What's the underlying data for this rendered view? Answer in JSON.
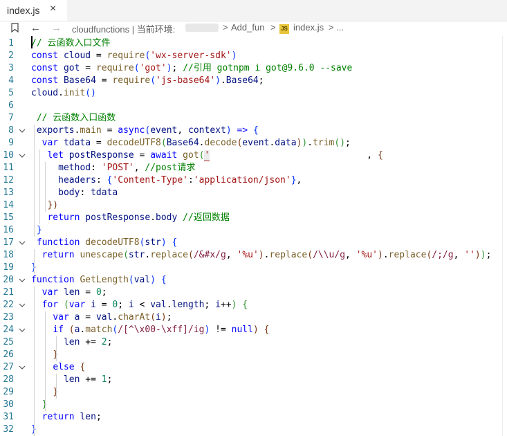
{
  "tab": {
    "filename": "index.js",
    "close_glyph": "×"
  },
  "breadcrumb": {
    "back_glyph": "←",
    "forward_glyph": "→",
    "path_part1": "cloudfunctions | 当前环境:",
    "sep1": ">",
    "path_folder": "Add_fun",
    "sep2": ">",
    "file_badge": "JS",
    "file": "index.js",
    "tail": "> ..."
  },
  "editor": {
    "lines": [
      {
        "n": "1",
        "fold": false,
        "tokens": [
          {
            "t": "// 云函数入口文件",
            "c": "com"
          }
        ]
      },
      {
        "n": "2",
        "fold": false,
        "tokens": [
          {
            "t": "const ",
            "c": "kw"
          },
          {
            "t": "cloud",
            "c": "var"
          },
          {
            "t": " = ",
            "c": ""
          },
          {
            "t": "require",
            "c": "fn"
          },
          {
            "t": "(",
            "c": "b1"
          },
          {
            "t": "'wx-server-sdk'",
            "c": "str"
          },
          {
            "t": ")",
            "c": "b1"
          }
        ]
      },
      {
        "n": "3",
        "fold": false,
        "tokens": [
          {
            "t": "const ",
            "c": "kw"
          },
          {
            "t": "got",
            "c": "var"
          },
          {
            "t": " = ",
            "c": ""
          },
          {
            "t": "require",
            "c": "fn"
          },
          {
            "t": "(",
            "c": "b1"
          },
          {
            "t": "'got'",
            "c": "str"
          },
          {
            "t": ")",
            "c": "b1"
          },
          {
            "t": "; ",
            "c": ""
          },
          {
            "t": "//引用 gotnpm i got@9.6.0 --save",
            "c": "com"
          }
        ]
      },
      {
        "n": "4",
        "fold": false,
        "tokens": [
          {
            "t": "const ",
            "c": "kw"
          },
          {
            "t": "Base64",
            "c": "var"
          },
          {
            "t": " = ",
            "c": ""
          },
          {
            "t": "require",
            "c": "fn"
          },
          {
            "t": "(",
            "c": "b1"
          },
          {
            "t": "'js-base64'",
            "c": "str"
          },
          {
            "t": ")",
            "c": "b1"
          },
          {
            "t": ".",
            "c": ""
          },
          {
            "t": "Base64",
            "c": "var"
          },
          {
            "t": ";",
            "c": ""
          }
        ]
      },
      {
        "n": "5",
        "fold": false,
        "tokens": [
          {
            "t": "cloud",
            "c": "var"
          },
          {
            "t": ".",
            "c": ""
          },
          {
            "t": "init",
            "c": "fn"
          },
          {
            "t": "()",
            "c": "b1"
          }
        ]
      },
      {
        "n": "6",
        "fold": false,
        "tokens": []
      },
      {
        "n": "7",
        "fold": false,
        "tokens": [
          {
            "t": " // 云函数入口函数",
            "c": "com"
          }
        ]
      },
      {
        "n": "8",
        "fold": true,
        "tokens": [
          {
            "t": " ",
            "c": ""
          },
          {
            "t": "exports",
            "c": "var"
          },
          {
            "t": ".",
            "c": ""
          },
          {
            "t": "main",
            "c": "fn"
          },
          {
            "t": " = ",
            "c": ""
          },
          {
            "t": "async",
            "c": "kw"
          },
          {
            "t": "(",
            "c": "b1"
          },
          {
            "t": "event",
            "c": "var"
          },
          {
            "t": ", ",
            "c": ""
          },
          {
            "t": "context",
            "c": "var"
          },
          {
            "t": ")",
            "c": "b1"
          },
          {
            "t": " => ",
            "c": "kw"
          },
          {
            "t": "{",
            "c": "b1"
          }
        ]
      },
      {
        "n": "9",
        "fold": false,
        "tokens": [
          {
            "t": "  ",
            "c": ""
          },
          {
            "t": "var ",
            "c": "kw"
          },
          {
            "t": "tdata",
            "c": "var"
          },
          {
            "t": " = ",
            "c": ""
          },
          {
            "t": "decodeUTF8",
            "c": "fn"
          },
          {
            "t": "(",
            "c": "b2"
          },
          {
            "t": "Base64",
            "c": "var"
          },
          {
            "t": ".",
            "c": ""
          },
          {
            "t": "decode",
            "c": "fn"
          },
          {
            "t": "(",
            "c": "b3"
          },
          {
            "t": "event",
            "c": "var"
          },
          {
            "t": ".",
            "c": ""
          },
          {
            "t": "data",
            "c": "var"
          },
          {
            "t": ")",
            "c": "b3"
          },
          {
            "t": ")",
            "c": "b2"
          },
          {
            "t": ".",
            "c": ""
          },
          {
            "t": "trim",
            "c": "fn"
          },
          {
            "t": "()",
            "c": "b2"
          },
          {
            "t": ";",
            "c": ""
          }
        ]
      },
      {
        "n": "10",
        "fold": true,
        "tokens": [
          {
            "t": "   ",
            "c": ""
          },
          {
            "t": "let ",
            "c": "kw"
          },
          {
            "t": "postResponse",
            "c": "var"
          },
          {
            "t": " = ",
            "c": ""
          },
          {
            "t": "await ",
            "c": "kw"
          },
          {
            "t": "got",
            "c": "fn"
          },
          {
            "t": "(",
            "c": "b2"
          },
          {
            "t": "'",
            "c": "str"
          },
          {
            "t": "                            ",
            "c": "str"
          },
          {
            "t": " , ",
            "c": ""
          },
          {
            "t": "{",
            "c": "b3"
          }
        ]
      },
      {
        "n": "11",
        "fold": false,
        "tokens": [
          {
            "t": "     ",
            "c": ""
          },
          {
            "t": "method",
            "c": "var"
          },
          {
            "t": ": ",
            "c": ""
          },
          {
            "t": "'POST'",
            "c": "str"
          },
          {
            "t": ", ",
            "c": ""
          },
          {
            "t": "//post请求",
            "c": "com"
          }
        ]
      },
      {
        "n": "12",
        "fold": false,
        "tokens": [
          {
            "t": "     ",
            "c": ""
          },
          {
            "t": "headers",
            "c": "var"
          },
          {
            "t": ": ",
            "c": ""
          },
          {
            "t": "{",
            "c": "b1"
          },
          {
            "t": "'Content-Type'",
            "c": "str"
          },
          {
            "t": ":",
            "c": ""
          },
          {
            "t": "'application/json'",
            "c": "str"
          },
          {
            "t": "}",
            "c": "b1"
          },
          {
            "t": ",",
            "c": ""
          }
        ]
      },
      {
        "n": "13",
        "fold": false,
        "tokens": [
          {
            "t": "     ",
            "c": ""
          },
          {
            "t": "body",
            "c": "var"
          },
          {
            "t": ": ",
            "c": ""
          },
          {
            "t": "tdata",
            "c": "var"
          }
        ]
      },
      {
        "n": "14",
        "fold": false,
        "tokens": [
          {
            "t": "   ",
            "c": ""
          },
          {
            "t": "})",
            "c": "b3"
          }
        ]
      },
      {
        "n": "15",
        "fold": false,
        "tokens": [
          {
            "t": "   ",
            "c": ""
          },
          {
            "t": "return ",
            "c": "kw"
          },
          {
            "t": "postResponse",
            "c": "var"
          },
          {
            "t": ".",
            "c": ""
          },
          {
            "t": "body",
            "c": "var"
          },
          {
            "t": " ",
            "c": ""
          },
          {
            "t": "//返回数据",
            "c": "com"
          }
        ]
      },
      {
        "n": "16",
        "fold": false,
        "tokens": [
          {
            "t": " ",
            "c": ""
          },
          {
            "t": "}",
            "c": "b1"
          }
        ]
      },
      {
        "n": "17",
        "fold": true,
        "tokens": [
          {
            "t": " ",
            "c": ""
          },
          {
            "t": "function ",
            "c": "kw"
          },
          {
            "t": "decodeUTF8",
            "c": "fn"
          },
          {
            "t": "(",
            "c": "b1"
          },
          {
            "t": "str",
            "c": "var"
          },
          {
            "t": ")",
            "c": "b1"
          },
          {
            "t": " ",
            "c": ""
          },
          {
            "t": "{",
            "c": "b1"
          }
        ]
      },
      {
        "n": "18",
        "fold": false,
        "tokens": [
          {
            "t": "  ",
            "c": ""
          },
          {
            "t": "return ",
            "c": "kw"
          },
          {
            "t": "unescape",
            "c": "fn"
          },
          {
            "t": "(",
            "c": "b2"
          },
          {
            "t": "str",
            "c": "var"
          },
          {
            "t": ".",
            "c": ""
          },
          {
            "t": "replace",
            "c": "fn"
          },
          {
            "t": "(",
            "c": "b3"
          },
          {
            "t": "/&#x/g",
            "c": "rx"
          },
          {
            "t": ", ",
            "c": ""
          },
          {
            "t": "'%u'",
            "c": "str"
          },
          {
            "t": ")",
            "c": "b3"
          },
          {
            "t": ".",
            "c": ""
          },
          {
            "t": "replace",
            "c": "fn"
          },
          {
            "t": "(",
            "c": "b3"
          },
          {
            "t": "/\\\\u/g",
            "c": "rx"
          },
          {
            "t": ", ",
            "c": ""
          },
          {
            "t": "'%u'",
            "c": "str"
          },
          {
            "t": ")",
            "c": "b3"
          },
          {
            "t": ".",
            "c": ""
          },
          {
            "t": "replace",
            "c": "fn"
          },
          {
            "t": "(",
            "c": "b3"
          },
          {
            "t": "/;/g",
            "c": "rx"
          },
          {
            "t": ", ",
            "c": ""
          },
          {
            "t": "''",
            "c": "str"
          },
          {
            "t": ")",
            "c": "b3"
          },
          {
            "t": ")",
            "c": "b2"
          },
          {
            "t": ";",
            "c": ""
          }
        ]
      },
      {
        "n": "19",
        "fold": false,
        "tokens": [
          {
            "t": "}",
            "c": "b1"
          }
        ]
      },
      {
        "n": "20",
        "fold": true,
        "tokens": [
          {
            "t": "function ",
            "c": "kw"
          },
          {
            "t": "GetLength",
            "c": "fn"
          },
          {
            "t": "(",
            "c": "b1"
          },
          {
            "t": "val",
            "c": "var"
          },
          {
            "t": ")",
            "c": "b1"
          },
          {
            "t": " ",
            "c": ""
          },
          {
            "t": "{",
            "c": "b1"
          }
        ]
      },
      {
        "n": "21",
        "fold": false,
        "tokens": [
          {
            "t": "  ",
            "c": ""
          },
          {
            "t": "var ",
            "c": "kw"
          },
          {
            "t": "len",
            "c": "var"
          },
          {
            "t": " = ",
            "c": ""
          },
          {
            "t": "0",
            "c": "num"
          },
          {
            "t": ";",
            "c": ""
          }
        ]
      },
      {
        "n": "22",
        "fold": true,
        "tokens": [
          {
            "t": "  ",
            "c": ""
          },
          {
            "t": "for ",
            "c": "kw"
          },
          {
            "t": "(",
            "c": "b2"
          },
          {
            "t": "var ",
            "c": "kw"
          },
          {
            "t": "i",
            "c": "var"
          },
          {
            "t": " = ",
            "c": ""
          },
          {
            "t": "0",
            "c": "num"
          },
          {
            "t": "; ",
            "c": ""
          },
          {
            "t": "i",
            "c": "var"
          },
          {
            "t": " < ",
            "c": ""
          },
          {
            "t": "val",
            "c": "var"
          },
          {
            "t": ".",
            "c": ""
          },
          {
            "t": "length",
            "c": "var"
          },
          {
            "t": "; ",
            "c": ""
          },
          {
            "t": "i",
            "c": "var"
          },
          {
            "t": "++",
            "c": ""
          },
          {
            "t": ")",
            "c": "b2"
          },
          {
            "t": " ",
            "c": ""
          },
          {
            "t": "{",
            "c": "b2"
          }
        ]
      },
      {
        "n": "23",
        "fold": false,
        "tokens": [
          {
            "t": "    ",
            "c": ""
          },
          {
            "t": "var ",
            "c": "kw"
          },
          {
            "t": "a",
            "c": "var"
          },
          {
            "t": " = ",
            "c": ""
          },
          {
            "t": "val",
            "c": "var"
          },
          {
            "t": ".",
            "c": ""
          },
          {
            "t": "charAt",
            "c": "fn"
          },
          {
            "t": "(",
            "c": "b3"
          },
          {
            "t": "i",
            "c": "var"
          },
          {
            "t": ")",
            "c": "b3"
          },
          {
            "t": ";",
            "c": ""
          }
        ]
      },
      {
        "n": "24",
        "fold": true,
        "tokens": [
          {
            "t": "    ",
            "c": ""
          },
          {
            "t": "if ",
            "c": "kw"
          },
          {
            "t": "(",
            "c": "b3"
          },
          {
            "t": "a",
            "c": "var"
          },
          {
            "t": ".",
            "c": ""
          },
          {
            "t": "match",
            "c": "fn"
          },
          {
            "t": "(",
            "c": "b1"
          },
          {
            "t": "/[^\\x00-\\xff]/ig",
            "c": "rx"
          },
          {
            "t": ")",
            "c": "b1"
          },
          {
            "t": " != ",
            "c": ""
          },
          {
            "t": "null",
            "c": "kw"
          },
          {
            "t": ")",
            "c": "b3"
          },
          {
            "t": " ",
            "c": ""
          },
          {
            "t": "{",
            "c": "b3"
          }
        ]
      },
      {
        "n": "25",
        "fold": false,
        "tokens": [
          {
            "t": "      ",
            "c": ""
          },
          {
            "t": "len",
            "c": "var"
          },
          {
            "t": " += ",
            "c": ""
          },
          {
            "t": "2",
            "c": "num"
          },
          {
            "t": ";",
            "c": ""
          }
        ]
      },
      {
        "n": "26",
        "fold": false,
        "tokens": [
          {
            "t": "    ",
            "c": ""
          },
          {
            "t": "}",
            "c": "b3"
          }
        ]
      },
      {
        "n": "27",
        "fold": true,
        "tokens": [
          {
            "t": "    ",
            "c": ""
          },
          {
            "t": "else ",
            "c": "kw"
          },
          {
            "t": "{",
            "c": "b3"
          }
        ]
      },
      {
        "n": "28",
        "fold": false,
        "tokens": [
          {
            "t": "      ",
            "c": ""
          },
          {
            "t": "len",
            "c": "var"
          },
          {
            "t": " += ",
            "c": ""
          },
          {
            "t": "1",
            "c": "num"
          },
          {
            "t": ";",
            "c": ""
          }
        ]
      },
      {
        "n": "29",
        "fold": false,
        "tokens": [
          {
            "t": "    ",
            "c": ""
          },
          {
            "t": "}",
            "c": "b3"
          }
        ]
      },
      {
        "n": "30",
        "fold": false,
        "tokens": [
          {
            "t": "  ",
            "c": ""
          },
          {
            "t": "}",
            "c": "b2"
          }
        ]
      },
      {
        "n": "31",
        "fold": false,
        "tokens": [
          {
            "t": "  ",
            "c": ""
          },
          {
            "t": "return ",
            "c": "kw"
          },
          {
            "t": "len",
            "c": "var"
          },
          {
            "t": ";",
            "c": ""
          }
        ]
      },
      {
        "n": "32",
        "fold": false,
        "tokens": [
          {
            "t": "}",
            "c": "b1"
          }
        ]
      }
    ]
  },
  "colors": {
    "keyword": "#0000ff",
    "function": "#795e26",
    "string": "#a31515",
    "comment": "#008000",
    "variable": "#001080",
    "number": "#098658",
    "regex": "#811f3f",
    "line_number": "#237893"
  }
}
